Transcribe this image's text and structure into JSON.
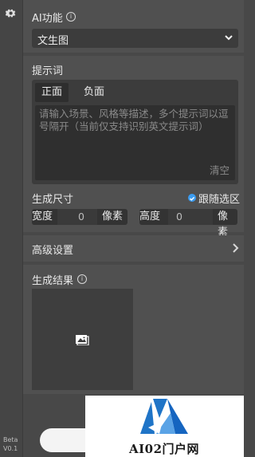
{
  "left_rail": {
    "gear_icon": "gear-icon",
    "beta_line1": "Beta",
    "beta_line2": "V0.1"
  },
  "ai_function": {
    "label": "AI功能",
    "info_icon": "info-icon",
    "selected": "文生图",
    "dropdown_icon": "chevron-down-icon"
  },
  "prompt": {
    "label": "提示词",
    "tabs": [
      "正面",
      "负面"
    ],
    "placeholder": "请输入场景、风格等描述，多个提示词以逗号隔开（当前仅支持识别英文提示词）",
    "clear": "清空"
  },
  "size": {
    "label": "生成尺寸",
    "follow_selection": "跟随选区",
    "follow_checked": true,
    "width_label": "宽度",
    "width_value": "0",
    "width_unit": "像素",
    "height_label": "高度",
    "height_value": "0",
    "height_unit": "像素"
  },
  "advanced": {
    "label": "高级设置",
    "arrow_icon": "chevron-right-icon"
  },
  "result": {
    "label": "生成结果",
    "info_icon": "info-icon",
    "placeholder_icon": "image-icon"
  },
  "watermark": {
    "text": "AI02门户网"
  },
  "colors": {
    "accent": "#3b9cf0",
    "panel_bg": "#505050",
    "input_bg": "#2f2f2f"
  }
}
